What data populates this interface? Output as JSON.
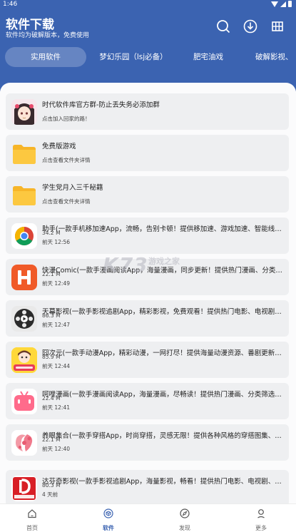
{
  "status_bar": {
    "time": "1:46"
  },
  "header": {
    "title": "软件下载",
    "subtitle": "软件均为破解版本，免费使用",
    "background": "#3b63b1",
    "icons": [
      "search-icon",
      "download-icon",
      "grid-icon"
    ]
  },
  "tabs": [
    {
      "label": "实用软件",
      "active": true
    },
    {
      "label": "梦幻乐园（lsj必备）",
      "active": false
    },
    {
      "label": "肥宅油戏",
      "active": false
    },
    {
      "label": "破解影视、",
      "active": false
    }
  ],
  "items": [
    {
      "name": "时代软件库官方群-防止丢失务必添加群",
      "line2": "点击加入回家的路！",
      "line3": "",
      "icon": "anime-girl-avatar"
    },
    {
      "name": "免费版游戏",
      "line2": "点击查看文件夹详情",
      "line3": "",
      "icon": "folder-icon"
    },
    {
      "name": "学生党月入三千秘籍",
      "line2": "点击查看文件夹详情",
      "line3": "",
      "icon": "folder-icon"
    },
    {
      "name": "助手(一款手机移加速App，流畅，告别卡顿！提供移加速、游戏加速、智能线路选择等...",
      "line2": "34.2 M",
      "line3": "前天 12:56",
      "icon": "chrome-like-icon"
    },
    {
      "name": "快漫Comic(一款手漫画阅读App，海量漫画，同步更新！提供热门漫画、分类筛选、更...",
      "line2": "22.1 M",
      "line3": "前天 12:49",
      "icon": "h-logo-icon"
    },
    {
      "name": "天幕影视(一款手影视追剧App，精彩影视，免费观看！提供热门电影、电视剧、综艺节...",
      "line2": "86.3 M",
      "line3": "前天 12:47",
      "icon": "film-reel-icon"
    },
    {
      "name": "囧次元(一款手动漫App，精彩动漫，一网打尽！提供海量动漫资源、番剧更新、弹幕互...",
      "line2": "85.9 M",
      "line3": "前天 12:44",
      "icon": "anime-badge-icon"
    },
    {
      "name": "呵哩漫画(一款手漫画阅读App，海量漫画，尽畅读！提供热门漫画、分类筛选、个性化...",
      "line2": "22.4 M",
      "line3": "前天 12:41",
      "icon": "pink-tv-icon"
    },
    {
      "name": "养眼集合(一款手穿搭App，时尚穿搭，灵感无限！提供各种风格的穿搭图集、搭配建议...",
      "line2": "22.1 M",
      "line3": "前天 12:40",
      "icon": "rose-woman-icon"
    },
    {
      "name": "达芬奇影视(一款手影视追剧App，海量影视，畅看！提供热门电影、电视剧、综艺节目...",
      "line2": "80.3 M",
      "line3": "4 天前",
      "icon": "davinci-icon"
    }
  ],
  "watermark": {
    "logo": "K73",
    "cn": "游戏之家",
    "url": ".com"
  },
  "bottom_nav": [
    {
      "label": "首页",
      "icon": "home-icon",
      "active": false
    },
    {
      "label": "软件",
      "icon": "cube-icon",
      "active": true
    },
    {
      "label": "发现",
      "icon": "compass-icon",
      "active": false
    },
    {
      "label": "更多",
      "icon": "person-icon",
      "active": false
    }
  ]
}
